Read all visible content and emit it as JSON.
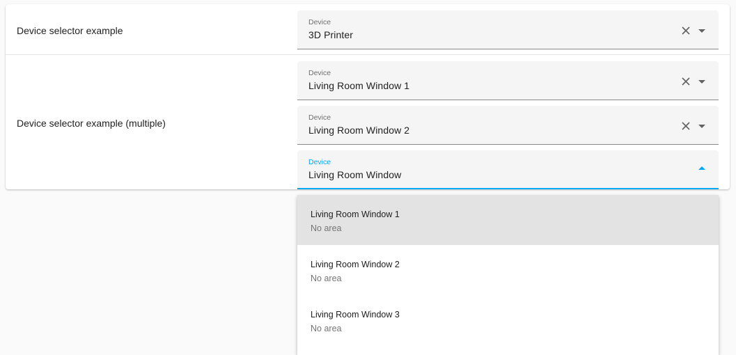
{
  "colors": {
    "accent": "#03a9f4",
    "field_bg": "#f5f5f5",
    "highlight_bg": "#e3e3e3"
  },
  "rows": [
    {
      "label": "Device selector example",
      "fields": [
        {
          "label": "Device",
          "value": "3D Printer",
          "icons": [
            "close-icon",
            "arrow-drop-down-icon"
          ]
        }
      ]
    },
    {
      "label": "Device selector example (multiple)",
      "fields": [
        {
          "label": "Device",
          "value": "Living Room Window 1",
          "icons": [
            "close-icon",
            "arrow-drop-down-icon"
          ]
        },
        {
          "label": "Device",
          "value": "Living Room Window 2",
          "icons": [
            "close-icon",
            "arrow-drop-down-icon"
          ]
        },
        {
          "label": "Device",
          "value": "Living Room Window",
          "focused": true,
          "icons": [
            "arrow-drop-up-icon"
          ]
        }
      ]
    }
  ],
  "dropdown": {
    "options": [
      {
        "name": "Living Room Window 1",
        "area": "No area",
        "highlighted": true
      },
      {
        "name": "Living Room Window 2",
        "area": "No area"
      },
      {
        "name": "Living Room Window 3",
        "area": "No area"
      }
    ]
  }
}
